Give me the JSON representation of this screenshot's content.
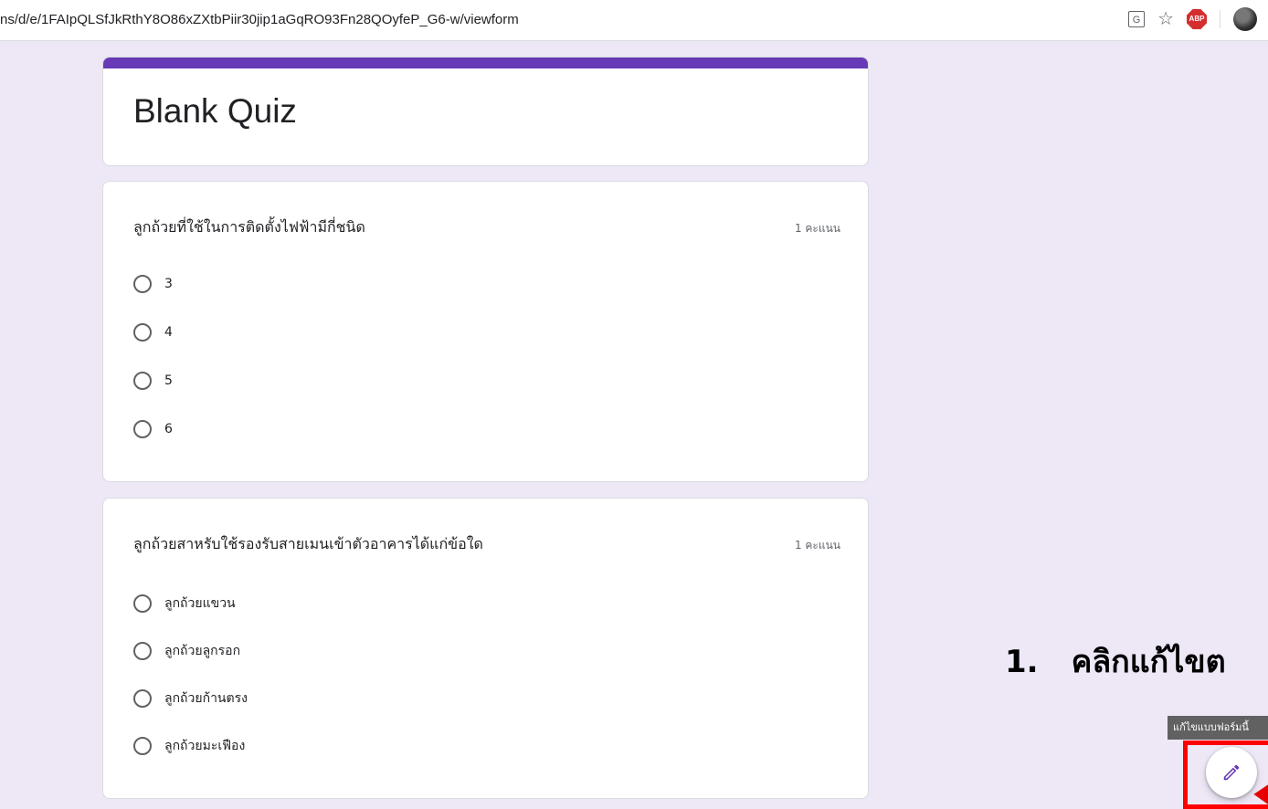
{
  "browser": {
    "url": "ns/d/e/1FAIpQLSfJkRthY8O86xZXtbPiir30jip1aGqRO93Fn28QOyfeP_G6-w/viewform",
    "abp_label": "ABP"
  },
  "form": {
    "title": "Blank Quiz"
  },
  "questions": [
    {
      "text": "ลูกถ้วยที่ใช้ในการติดตั้งไฟฟ้ามีกี่ชนิด",
      "points": "1 คะแนน",
      "options": [
        "3",
        "4",
        "5",
        "6"
      ]
    },
    {
      "text": "ลูกถ้วยสาหรับใช้รองรับสายเมนเข้าตัวอาคารได้แก่ข้อใด",
      "points": "1 คะแนน",
      "options": [
        "ลูกถ้วยแขวน",
        "ลูกถ้วยลูกรอก",
        "ลูกถ้วยก้านตรง",
        "ลูกถ้วยมะเฟือง"
      ]
    }
  ],
  "annotation": {
    "number": "1.",
    "text": "คลิกแก้ไขต"
  },
  "tooltip": {
    "text": "แก้ไขแบบฟอร์มนี้"
  },
  "colors": {
    "accent": "#673ab7",
    "background": "#ede7f6",
    "highlight": "#ff0000"
  }
}
